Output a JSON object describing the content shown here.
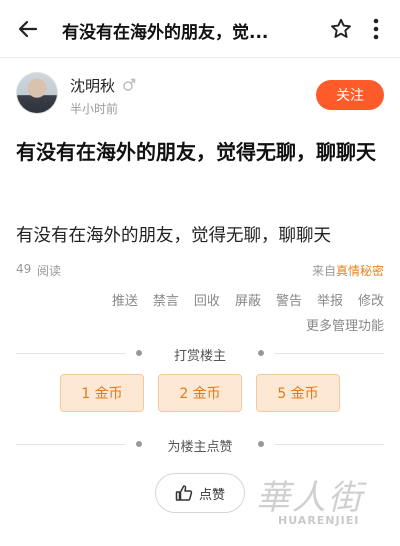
{
  "topbar": {
    "title": "有没有在海外的朋友，觉...",
    "back_icon": "arrow-left-icon",
    "star_icon": "star-outline-icon",
    "more_icon": "vertical-ellipsis-icon"
  },
  "author": {
    "name": "沈明秋",
    "gender_icon": "male-icon",
    "time": "半小时前",
    "follow_label": "关注"
  },
  "post": {
    "title": "有没有在海外的朋友，觉得无聊，聊聊天",
    "body": "有没有在海外的朋友，觉得无聊，聊聊天",
    "read_count": "49",
    "read_label": "阅读",
    "source_prefix": "来自",
    "source_name": "真情秘密"
  },
  "admin": {
    "actions": [
      "推送",
      "禁言",
      "回收",
      "屏蔽",
      "警告",
      "举报",
      "修改"
    ],
    "more": "更多管理功能"
  },
  "reward": {
    "heading": "打赏楼主",
    "options": [
      "1 金币",
      "2 金币",
      "5 金币"
    ]
  },
  "like": {
    "heading": "为楼主点赞",
    "button_label": "点赞",
    "icon": "thumbs-up-icon"
  },
  "watermark": {
    "main": "華人街",
    "sub": "HUARENJIEI"
  },
  "colors": {
    "accent": "#ff5a2a",
    "source_link": "#e8821e",
    "coin_bg": "#fde8d4",
    "coin_text": "#e07a1a"
  }
}
